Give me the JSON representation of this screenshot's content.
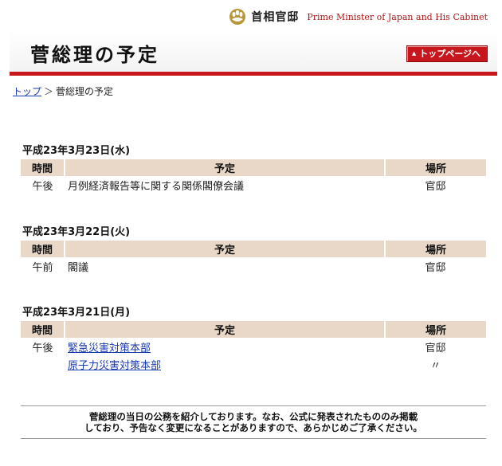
{
  "header": {
    "brand_jp": "首相官邸",
    "brand_en": "Prime Minister of Japan and His Cabinet",
    "page_title": "菅総理の予定",
    "top_button_label": "トップページへ"
  },
  "breadcrumb": {
    "home": "トップ",
    "separator": "＞",
    "current": "菅総理の予定"
  },
  "table_headers": {
    "time": "時間",
    "event": "予定",
    "place": "場所"
  },
  "days": [
    {
      "date": "平成23年3月23日(水)",
      "rows": [
        {
          "time": "午後",
          "event": "月例経済報告等に関する関係閣僚会議",
          "place": "官邸"
        }
      ]
    },
    {
      "date": "平成23年3月22日(火)",
      "rows": [
        {
          "time": "午前",
          "event": "閣議",
          "place": "官邸"
        }
      ]
    },
    {
      "date": "平成23年3月21日(月)",
      "rows": [
        {
          "time": "午後",
          "event": "緊急災害対策本部",
          "place": "官邸"
        },
        {
          "time": "",
          "event": "原子力災害対策本部",
          "place": "〃"
        }
      ]
    }
  ],
  "footer": {
    "line1": "菅総理の当日の公務を紹介しております。なお、公式に発表されたもののみ掲載",
    "line2": "しており、予告なく変更になることがありますので、あらかじめご了承ください。"
  }
}
